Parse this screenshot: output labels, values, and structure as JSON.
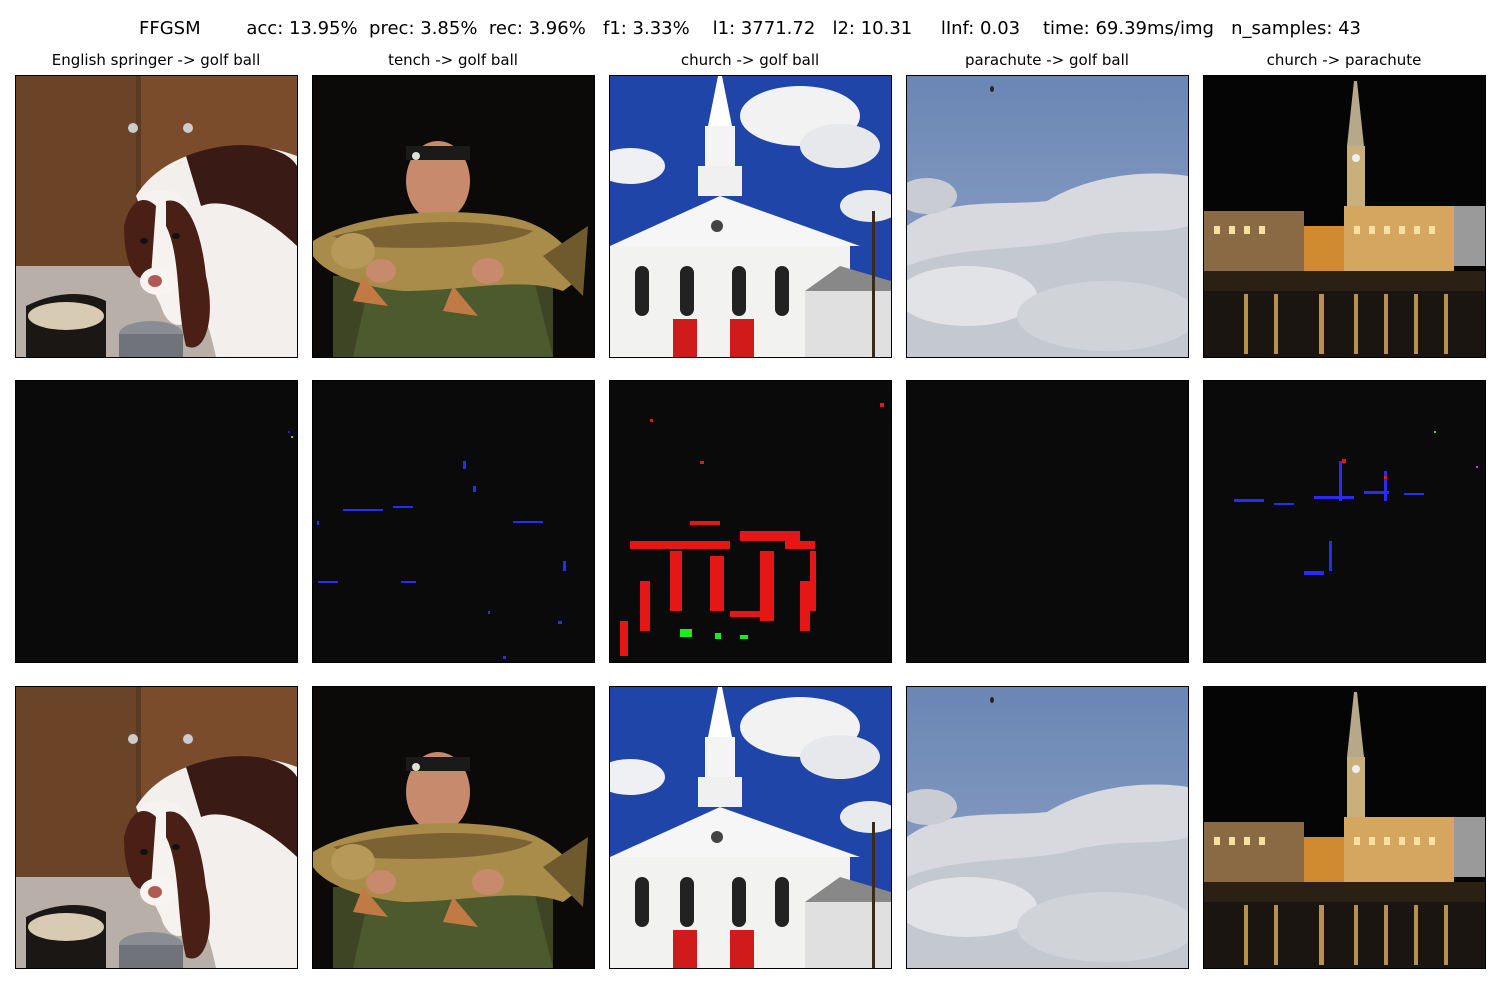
{
  "figure": {
    "title": "FFGSM        acc: 13.95%  prec: 3.85%  rec: 3.96%   f1: 3.33%    l1: 3771.72   l2: 10.31     lInf: 0.03    time: 69.39ms/img   n_samples: 43"
  },
  "columns": [
    {
      "title": "English springer -> golf ball",
      "subject": "springer-spaniel-dog"
    },
    {
      "title": "tench -> golf ball",
      "subject": "man-holding-fish"
    },
    {
      "title": "church -> golf ball",
      "subject": "white-church"
    },
    {
      "title": "parachute -> golf ball",
      "subject": "sky-clouds"
    },
    {
      "title": "church -> parachute",
      "subject": "church-night-river"
    }
  ],
  "rows": [
    "original-image",
    "perturbation",
    "adversarial-image"
  ],
  "colors": {
    "perturbation_red": "#ff1a1a",
    "perturbation_blue": "#1a1aff",
    "perturbation_green": "#1aff1a",
    "background": "#ffffff"
  }
}
